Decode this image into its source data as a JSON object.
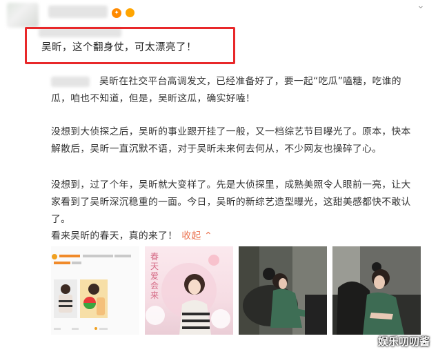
{
  "post": {
    "title": "吴昕，这个翻身仗，可太漂亮了！",
    "chevron": "⌄",
    "paragraphs": [
      "吴昕在社交平台高调发文，已经准备好了，要一起“吃瓜”嗑糖，吃谁的瓜，咱也不知道，但是，吴昕这瓜，确实好嗑！",
      "没想到大侦探之后，吴昕的事业跟开挂了一般，又一档综艺节目曝光了。原本，快本解散后，吴昕一直沉默不语，对于吴昕未来何去何从，不少网友也操碎了心。",
      "没想到，过了个年，吴昕就大变样了。先是大侦探里，成熟美照令人眼前一亮，让大家看到了吴昕深沉稳重的一面。今日，吴昕的新综艺造型曝光，这甜美感都快不敢认了。",
      "看来吴昕的春天，真的来了！"
    ],
    "more_link": "收起",
    "more_icon": "⌃"
  },
  "thumbnails": [
    {
      "name": "screenshot-thumbnail",
      "caption": ""
    },
    {
      "name": "poster-thumbnail",
      "caption": "春天爱会来"
    },
    {
      "name": "photo-thumbnail-1",
      "caption": ""
    },
    {
      "name": "photo-thumbnail-2",
      "caption": ""
    }
  ],
  "watermark": "娱乐叨叨酱",
  "colors": {
    "highlight": "#e8282a",
    "link": "#eb7350"
  }
}
